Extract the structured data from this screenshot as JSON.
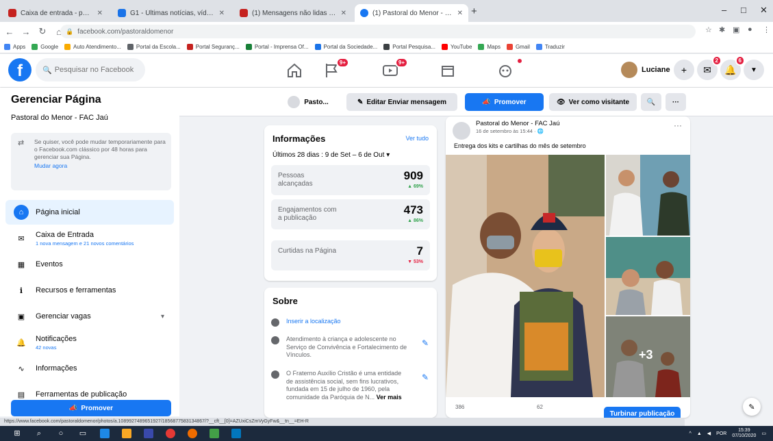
{
  "browser": {
    "tabs": [
      {
        "title": "Caixa de entrada - pastoraldom...",
        "favicon_color": "#c5221f"
      },
      {
        "title": "G1 - Últimas notícias, vídeos e fo...",
        "favicon_color": "#1a73e8"
      },
      {
        "title": "(1) Mensagens não lidas - Facebo...",
        "favicon_color": "#c5221f"
      },
      {
        "title": "(1) Pastoral do Menor - FAC Jaú",
        "favicon_color": "#1877f2"
      }
    ],
    "new_tab_glyph": "+",
    "window_controls": [
      "–",
      "□",
      "✕"
    ],
    "url": "facebook.com/pastoraldomenor",
    "bookmarks": [
      "Apps",
      "Google",
      "Auto Atendimento...",
      "Portal da Escola...",
      "Portal Seguranç...",
      "Portal - Imprensa Of...",
      "Portal da Sociedade...",
      "Portal Pesquisa...",
      "YouTube",
      "Maps",
      "Gmail",
      "Traduzir"
    ],
    "status_url": "https://www.facebook.com/pastoraldomenor/photos/a.1089927489651927/1856877583134867/?__cft__[0]=AZUxiCsZmVyGyFw&__tn__=EH-R",
    "taskbar_time": "15:39",
    "taskbar_date": "07/10/2020"
  },
  "fb": {
    "logo": "f",
    "search_placeholder": "Pesquisar no Facebook",
    "nav_badges": {
      "pages": "9+",
      "watch": "9+",
      "gaming": ""
    },
    "profile_name": "Luciane",
    "right_badges": {
      "messenger": "2",
      "notifications": "6"
    }
  },
  "sidebar": {
    "title": "Gerenciar Página",
    "page_name": "Pastoral do Menor - FAC Jaú",
    "tip_text": "Se quiser, você pode mudar temporariamente para o Facebook.com clássico por 48 horas para gerenciar sua Página.",
    "tip_link": "Mudar agora",
    "items": [
      {
        "label": "Página inicial",
        "icon": "home-icon",
        "glyph": "⌂"
      },
      {
        "label": "Caixa de Entrada",
        "icon": "inbox-icon",
        "glyph": "✉",
        "sub": "1 nova mensagem e 21 novos comentários"
      },
      {
        "label": "Eventos",
        "icon": "calendar-icon",
        "glyph": "▦"
      },
      {
        "label": "Recursos e ferramentas",
        "icon": "info-icon",
        "glyph": "ℹ"
      },
      {
        "label": "Gerenciar vagas",
        "icon": "briefcase-icon",
        "glyph": "▣"
      },
      {
        "label": "Notificações",
        "icon": "bell-icon",
        "glyph": "🔔",
        "sub": "42 novas"
      },
      {
        "label": "Informações",
        "icon": "insights-icon",
        "glyph": "∿"
      },
      {
        "label": "Ferramentas de publicação",
        "icon": "tools-icon",
        "glyph": "▤"
      }
    ],
    "promote_label": "Promover"
  },
  "actionbar": {
    "page_short": "Pasto...",
    "edit_send": "Editar Enviar mensagem",
    "promote": "Promover",
    "view_as": "Ver como visitante",
    "more": "···"
  },
  "insights": {
    "title": "Informações",
    "see_all": "Ver tudo",
    "period": "Últimos 28 dias : 9 de Set – 6 de Out",
    "metrics": [
      {
        "label": "Pessoas alcançadas",
        "value": "909",
        "change": "▲ 69%",
        "color": "#31a24c"
      },
      {
        "label": "Engajamentos com a publicação",
        "value": "473",
        "change": "▲ 86%",
        "color": "#31a24c"
      },
      {
        "label": "Curtidas na Página",
        "value": "7",
        "change": "▼ 53%",
        "color": "#e41e3f"
      }
    ]
  },
  "about": {
    "title": "Sobre",
    "location": "Inserir a localização",
    "desc1": "Atendimento à criança e adolescente no Serviço de Convivência e Fortalecimento de Vínculos.",
    "desc2": "O Fraterno Auxílio Cristão é uma entidade de assistência social, sem fins lucrativos, fundada em 15 de julho de 1960, pela comunidade da Paróquia de N...",
    "see_more": "Ver mais"
  },
  "post": {
    "author": "Pastoral do Menor - FAC Jaú",
    "date": "16 de setembro às 15:44 · 🌐",
    "text": "Entrega dos kits e cartilhas do mês de setembro",
    "more_photos": "+3",
    "reach": "386",
    "engagement": "62",
    "boost": "Turbinar publicação"
  }
}
